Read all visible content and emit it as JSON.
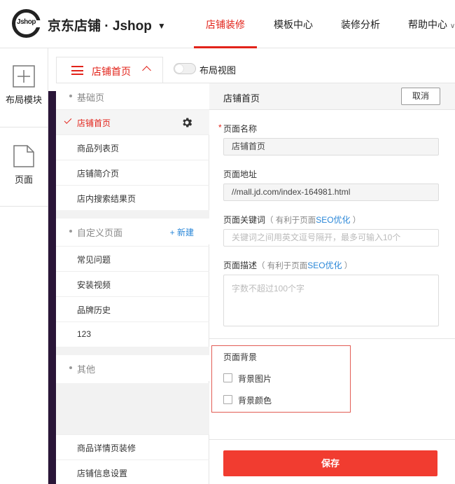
{
  "header": {
    "logo_text": "Jshop",
    "brand": "京东店铺 · Jshop",
    "nav": [
      {
        "label": "店铺装修",
        "active": true
      },
      {
        "label": "模板中心",
        "active": false
      },
      {
        "label": "装修分析",
        "active": false
      },
      {
        "label": "帮助中心",
        "active": false
      }
    ],
    "accent_color": "#e2231a"
  },
  "rail": {
    "items": [
      {
        "label": "布局模块",
        "icon": "plus-box-icon"
      },
      {
        "label": "页面",
        "icon": "page-icon"
      }
    ]
  },
  "toolbar": {
    "page_selector": "店铺首页",
    "toggle_label": "布局视图",
    "toggle_on": false
  },
  "page_list": {
    "groups": [
      {
        "title": "基础页",
        "items": [
          "店铺首页",
          "商品列表页",
          "店铺简介页",
          "店内搜索结果页"
        ]
      },
      {
        "title": "自定义页面",
        "add_label": "+ 新建",
        "items": [
          "常见问题",
          "安装视频",
          "品牌历史",
          "123"
        ]
      },
      {
        "title": "其他",
        "items": []
      }
    ],
    "active_item": "店铺首页",
    "bottom_items": [
      "商品详情页装修",
      "店铺信息设置"
    ]
  },
  "form": {
    "header_title": "店铺首页",
    "cancel_label": "取消",
    "name_label": "页面名称",
    "name_value": "店铺首页",
    "url_label": "页面地址",
    "url_value": "//mall.jd.com/index-164981.html",
    "keywords_label": "页面关键词",
    "keywords_hint_prefix": "（ 有利于页面",
    "keywords_hint_link": "SEO优化",
    "keywords_hint_suffix": " ）",
    "keywords_placeholder": "关键词之间用英文逗号隔开，最多可输入10个",
    "desc_label": "页面描述",
    "desc_hint_prefix": "（ 有利于页面",
    "desc_hint_link": "SEO优化",
    "desc_hint_suffix": " ）",
    "desc_placeholder": "字数不超过100个字",
    "bg_title": "页面背景",
    "bg_image_label": "背景图片",
    "bg_color_label": "背景颜色",
    "save_label": "保存",
    "save_color": "#f13c30"
  }
}
